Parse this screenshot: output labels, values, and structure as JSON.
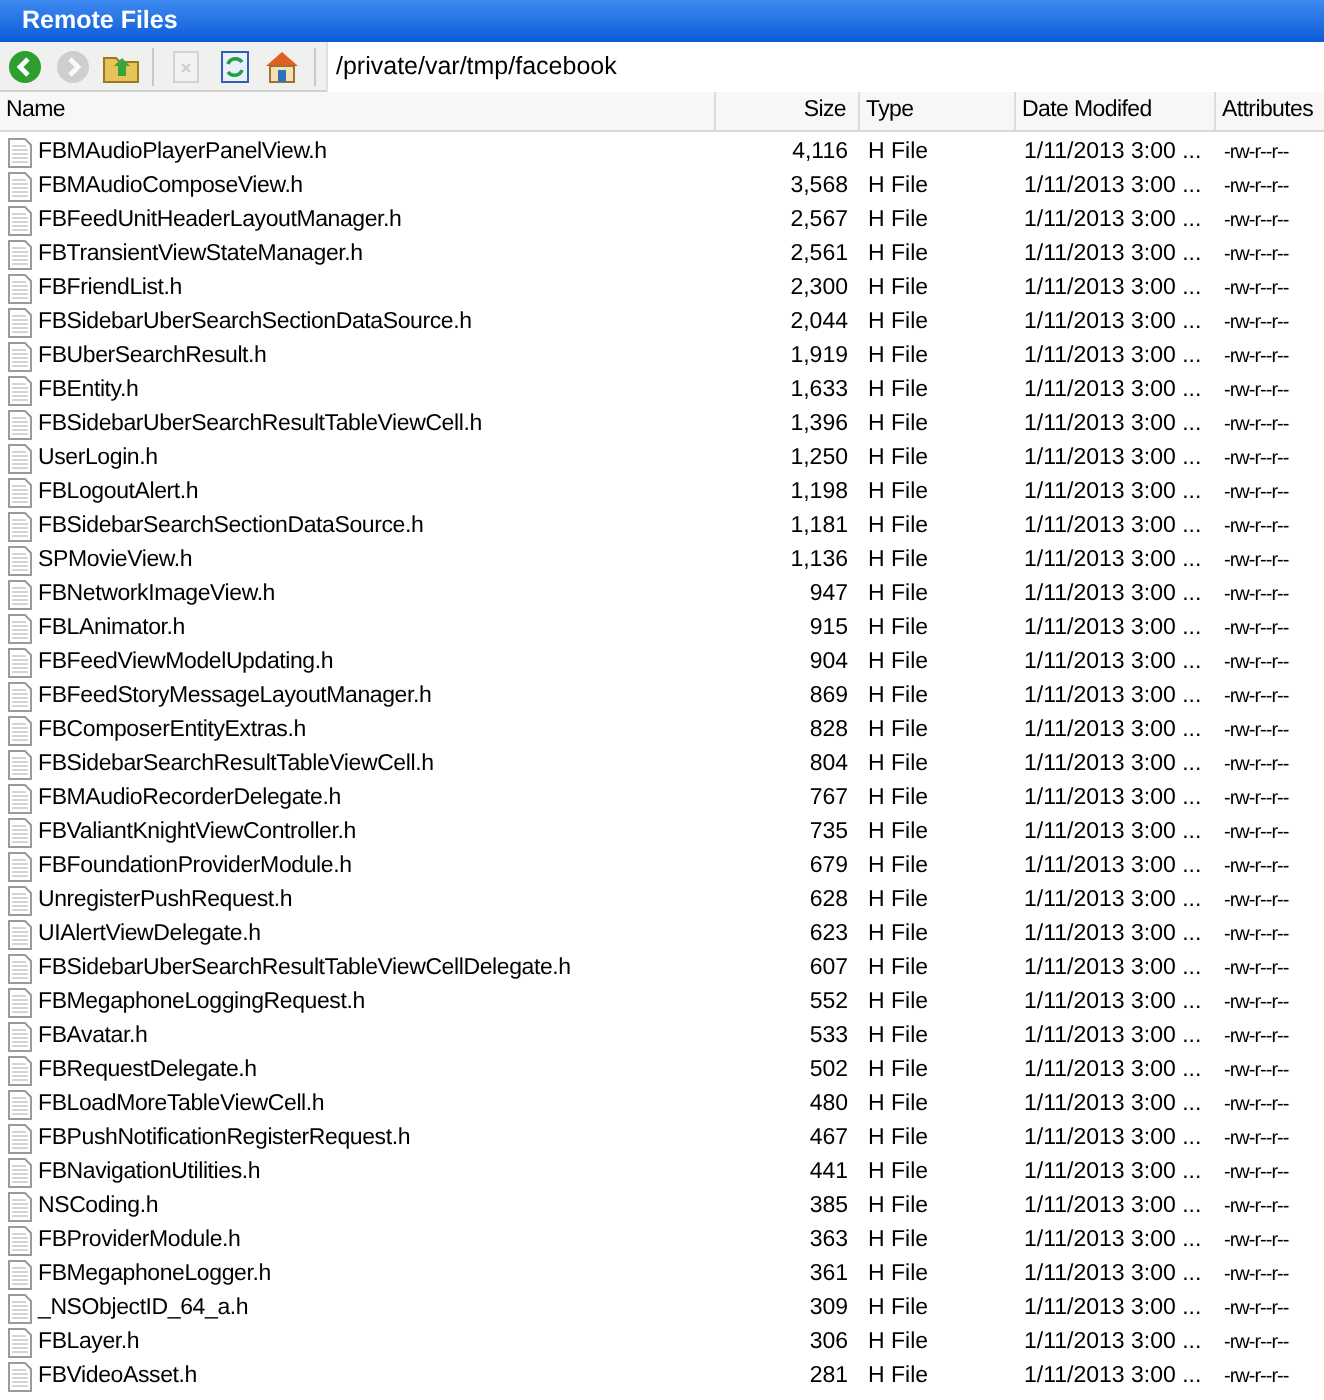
{
  "window": {
    "title": "Remote Files"
  },
  "toolbar": {
    "buttons": [
      {
        "kind": "back",
        "disabled": false
      },
      {
        "kind": "forward",
        "disabled": true
      },
      {
        "kind": "up",
        "disabled": false
      },
      {
        "kind": "separator"
      },
      {
        "kind": "delete",
        "disabled": true
      },
      {
        "kind": "refresh",
        "disabled": false
      },
      {
        "kind": "home",
        "disabled": false
      }
    ],
    "path": "/private/var/tmp/facebook"
  },
  "table": {
    "columns": [
      "Name",
      "Size",
      "Type",
      "Date Modifed",
      "Attributes"
    ],
    "rows": [
      {
        "name": "FBMAudioPlayerPanelView.h",
        "size": "4,116",
        "type": "H File",
        "date": "1/11/2013 3:00 ...",
        "attributes": "-rw-r--r--"
      },
      {
        "name": "FBMAudioComposeView.h",
        "size": "3,568",
        "type": "H File",
        "date": "1/11/2013 3:00 ...",
        "attributes": "-rw-r--r--"
      },
      {
        "name": "FBFeedUnitHeaderLayoutManager.h",
        "size": "2,567",
        "type": "H File",
        "date": "1/11/2013 3:00 ...",
        "attributes": "-rw-r--r--"
      },
      {
        "name": "FBTransientViewStateManager.h",
        "size": "2,561",
        "type": "H File",
        "date": "1/11/2013 3:00 ...",
        "attributes": "-rw-r--r--"
      },
      {
        "name": "FBFriendList.h",
        "size": "2,300",
        "type": "H File",
        "date": "1/11/2013 3:00 ...",
        "attributes": "-rw-r--r--"
      },
      {
        "name": "FBSidebarUberSearchSectionDataSource.h",
        "size": "2,044",
        "type": "H File",
        "date": "1/11/2013 3:00 ...",
        "attributes": "-rw-r--r--"
      },
      {
        "name": "FBUberSearchResult.h",
        "size": "1,919",
        "type": "H File",
        "date": "1/11/2013 3:00 ...",
        "attributes": "-rw-r--r--"
      },
      {
        "name": "FBEntity.h",
        "size": "1,633",
        "type": "H File",
        "date": "1/11/2013 3:00 ...",
        "attributes": "-rw-r--r--"
      },
      {
        "name": "FBSidebarUberSearchResultTableViewCell.h",
        "size": "1,396",
        "type": "H File",
        "date": "1/11/2013 3:00 ...",
        "attributes": "-rw-r--r--"
      },
      {
        "name": "UserLogin.h",
        "size": "1,250",
        "type": "H File",
        "date": "1/11/2013 3:00 ...",
        "attributes": "-rw-r--r--"
      },
      {
        "name": "FBLogoutAlert.h",
        "size": "1,198",
        "type": "H File",
        "date": "1/11/2013 3:00 ...",
        "attributes": "-rw-r--r--"
      },
      {
        "name": "FBSidebarSearchSectionDataSource.h",
        "size": "1,181",
        "type": "H File",
        "date": "1/11/2013 3:00 ...",
        "attributes": "-rw-r--r--"
      },
      {
        "name": "SPMovieView.h",
        "size": "1,136",
        "type": "H File",
        "date": "1/11/2013 3:00 ...",
        "attributes": "-rw-r--r--"
      },
      {
        "name": "FBNetworkImageView.h",
        "size": "947",
        "type": "H File",
        "date": "1/11/2013 3:00 ...",
        "attributes": "-rw-r--r--"
      },
      {
        "name": "FBLAnimator.h",
        "size": "915",
        "type": "H File",
        "date": "1/11/2013 3:00 ...",
        "attributes": "-rw-r--r--"
      },
      {
        "name": "FBFeedViewModelUpdating.h",
        "size": "904",
        "type": "H File",
        "date": "1/11/2013 3:00 ...",
        "attributes": "-rw-r--r--"
      },
      {
        "name": "FBFeedStoryMessageLayoutManager.h",
        "size": "869",
        "type": "H File",
        "date": "1/11/2013 3:00 ...",
        "attributes": "-rw-r--r--"
      },
      {
        "name": "FBComposerEntityExtras.h",
        "size": "828",
        "type": "H File",
        "date": "1/11/2013 3:00 ...",
        "attributes": "-rw-r--r--"
      },
      {
        "name": "FBSidebarSearchResultTableViewCell.h",
        "size": "804",
        "type": "H File",
        "date": "1/11/2013 3:00 ...",
        "attributes": "-rw-r--r--"
      },
      {
        "name": "FBMAudioRecorderDelegate.h",
        "size": "767",
        "type": "H File",
        "date": "1/11/2013 3:00 ...",
        "attributes": "-rw-r--r--"
      },
      {
        "name": "FBValiantKnightViewController.h",
        "size": "735",
        "type": "H File",
        "date": "1/11/2013 3:00 ...",
        "attributes": "-rw-r--r--"
      },
      {
        "name": "FBFoundationProviderModule.h",
        "size": "679",
        "type": "H File",
        "date": "1/11/2013 3:00 ...",
        "attributes": "-rw-r--r--"
      },
      {
        "name": "UnregisterPushRequest.h",
        "size": "628",
        "type": "H File",
        "date": "1/11/2013 3:00 ...",
        "attributes": "-rw-r--r--"
      },
      {
        "name": "UIAlertViewDelegate.h",
        "size": "623",
        "type": "H File",
        "date": "1/11/2013 3:00 ...",
        "attributes": "-rw-r--r--"
      },
      {
        "name": "FBSidebarUberSearchResultTableViewCellDelegate.h",
        "size": "607",
        "type": "H File",
        "date": "1/11/2013 3:00 ...",
        "attributes": "-rw-r--r--"
      },
      {
        "name": "FBMegaphoneLoggingRequest.h",
        "size": "552",
        "type": "H File",
        "date": "1/11/2013 3:00 ...",
        "attributes": "-rw-r--r--"
      },
      {
        "name": "FBAvatar.h",
        "size": "533",
        "type": "H File",
        "date": "1/11/2013 3:00 ...",
        "attributes": "-rw-r--r--"
      },
      {
        "name": "FBRequestDelegate.h",
        "size": "502",
        "type": "H File",
        "date": "1/11/2013 3:00 ...",
        "attributes": "-rw-r--r--"
      },
      {
        "name": "FBLoadMoreTableViewCell.h",
        "size": "480",
        "type": "H File",
        "date": "1/11/2013 3:00 ...",
        "attributes": "-rw-r--r--"
      },
      {
        "name": "FBPushNotificationRegisterRequest.h",
        "size": "467",
        "type": "H File",
        "date": "1/11/2013 3:00 ...",
        "attributes": "-rw-r--r--"
      },
      {
        "name": "FBNavigationUtilities.h",
        "size": "441",
        "type": "H File",
        "date": "1/11/2013 3:00 ...",
        "attributes": "-rw-r--r--"
      },
      {
        "name": "NSCoding.h",
        "size": "385",
        "type": "H File",
        "date": "1/11/2013 3:00 ...",
        "attributes": "-rw-r--r--"
      },
      {
        "name": "FBProviderModule.h",
        "size": "363",
        "type": "H File",
        "date": "1/11/2013 3:00 ...",
        "attributes": "-rw-r--r--"
      },
      {
        "name": "FBMegaphoneLogger.h",
        "size": "361",
        "type": "H File",
        "date": "1/11/2013 3:00 ...",
        "attributes": "-rw-r--r--"
      },
      {
        "name": "_NSObjectID_64_a.h",
        "size": "309",
        "type": "H File",
        "date": "1/11/2013 3:00 ...",
        "attributes": "-rw-r--r--"
      },
      {
        "name": "FBLayer.h",
        "size": "306",
        "type": "H File",
        "date": "1/11/2013 3:00 ...",
        "attributes": "-rw-r--r--"
      },
      {
        "name": "FBVideoAsset.h",
        "size": "281",
        "type": "H File",
        "date": "1/11/2013 3:00 ...",
        "attributes": "-rw-r--r--"
      }
    ]
  }
}
